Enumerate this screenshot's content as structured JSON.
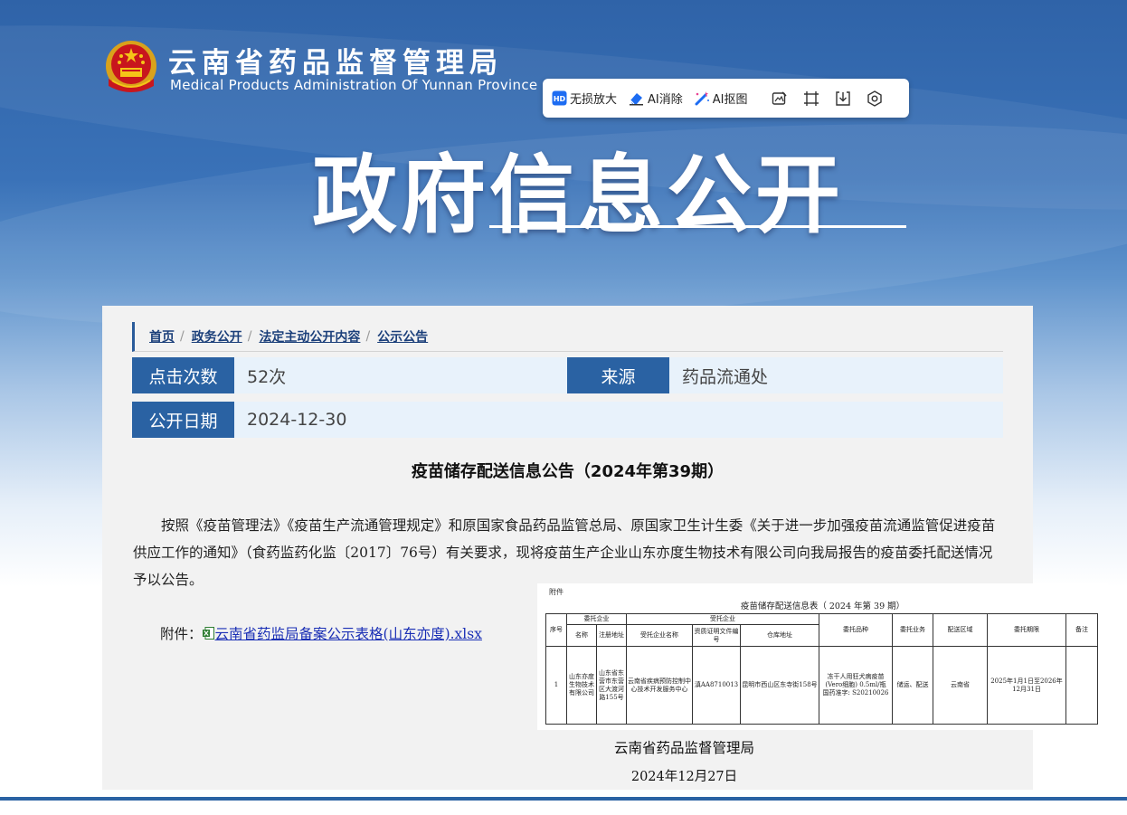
{
  "header": {
    "site_title": "云南省药品监督管理局",
    "site_subtitle": "Medical Products Administration Of Yunnan Province",
    "hero_title": "政府信息公开"
  },
  "toolbar": {
    "hd_badge": "HD",
    "lossless_zoom": "无损放大",
    "ai_erase": "AI消除",
    "ai_cutout": "AI抠图",
    "icons": [
      "edit-icon",
      "crop-icon",
      "download-icon",
      "settings-icon"
    ]
  },
  "breadcrumb": {
    "items": [
      "首页",
      "政务公开",
      "法定主动公开内容",
      "公示公告"
    ],
    "separator": "/"
  },
  "info": {
    "clicks_label": "点击次数",
    "clicks_value": "52次",
    "source_label": "来源",
    "source_value": "药品流通处",
    "date_label": "公开日期",
    "date_value": "2024-12-30"
  },
  "article": {
    "title": "疫苗储存配送信息公告（2024年第39期）",
    "body": "按照《疫苗管理法》《疫苗生产流通管理规定》和原国家食品药品监管总局、原国家卫生计生委《关于进一步加强疫苗流通监管促进疫苗供应工作的通知》（食药监药化监〔2017〕76号）有关要求，现将疫苗生产企业山东亦度生物技术有限公司向我局报告的疫苗委托配送情况予以公告。",
    "attachment_label": "附件：",
    "attachment_link": "云南省药监局备案公示表格(山东亦度).xlsx",
    "signature_org": "云南省药品监督管理局",
    "signature_date": "2024年12月27日"
  },
  "table_image": {
    "attachment_tag": "附件",
    "title": "疫苗储存配送信息表（  2024   年第 39 期）",
    "headers": {
      "seq": "序号",
      "entrusting": "委托企业",
      "entrusted": "受托企业",
      "name": "名称",
      "address": "注册地址",
      "entrusted_name": "受托企业名称",
      "cert_no": "资质证明文件编号",
      "warehouse": "仓库地址",
      "variety": "委托品种",
      "business": "委托业务",
      "region": "配送区域",
      "period": "委托期限",
      "remark": "备注"
    },
    "row": {
      "seq": "1",
      "name": "山东亦度生物技术有限公司",
      "address": "山东省东营市东营区大渡河路155号",
      "entrusted_name": "云南省疾病预防控制中心技术开发服务中心",
      "cert_no": "滇AA8710013",
      "warehouse": "昆明市西山区东寺街158号",
      "variety": "冻干人用狂犬病疫苗(Vero细胞) 0.5ml/瓶　国药准字: S20210026",
      "business": "储运、配送",
      "region": "云南省",
      "period": "2025年1月1日至2026年12月31日",
      "remark": ""
    }
  }
}
